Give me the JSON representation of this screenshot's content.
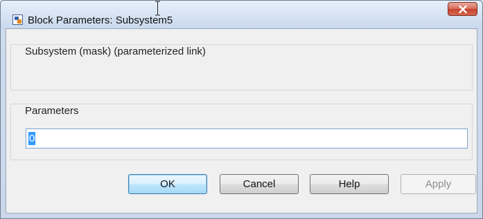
{
  "window": {
    "title": "Block Parameters: Subsystem5"
  },
  "mask_group": {
    "label": "Subsystem (mask) (parameterized link)"
  },
  "params_group": {
    "label": "Parameters",
    "field_value": "0"
  },
  "buttons": {
    "ok": "OK",
    "cancel": "Cancel",
    "help": "Help",
    "apply": "Apply"
  },
  "colors": {
    "close_button": "#c6432f",
    "selection": "#3399ff"
  }
}
